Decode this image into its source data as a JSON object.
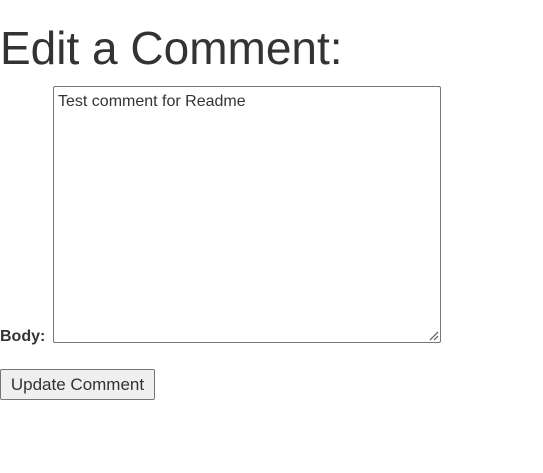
{
  "page": {
    "title": "Edit a Comment:"
  },
  "form": {
    "body_label": "Body:",
    "body_value": "Test comment for Readme",
    "submit_label": "Update Comment"
  }
}
